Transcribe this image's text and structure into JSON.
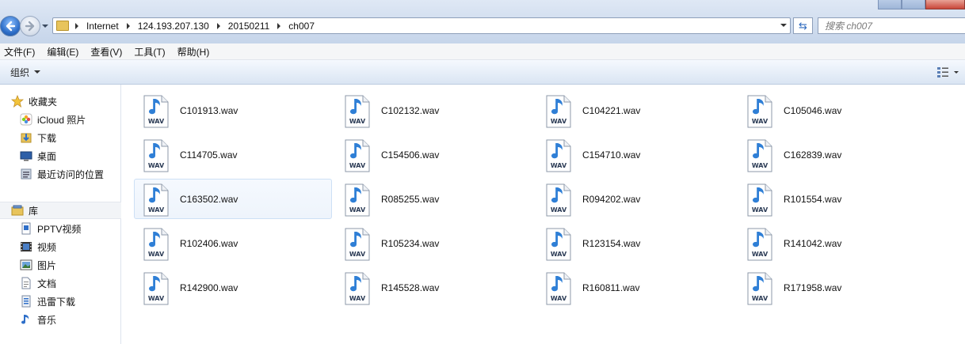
{
  "address": {
    "breadcrumbs": [
      "Internet",
      "124.193.207.130",
      "20150211",
      "ch007"
    ]
  },
  "search": {
    "placeholder": "搜索 ch007"
  },
  "menu": [
    "文件(F)",
    "编辑(E)",
    "查看(V)",
    "工具(T)",
    "帮助(H)"
  ],
  "toolbar": {
    "organize_label": "组织"
  },
  "nav": {
    "favorites_label": "收藏夹",
    "favorites": [
      {
        "label": "iCloud 照片",
        "icon": "icloud-photos-icon"
      },
      {
        "label": "下载",
        "icon": "downloads-icon"
      },
      {
        "label": "桌面",
        "icon": "desktop-icon"
      },
      {
        "label": "最近访问的位置",
        "icon": "recent-places-icon"
      }
    ],
    "libraries_label": "库",
    "libraries": [
      {
        "label": "PPTV视频",
        "icon": "pptv-video-icon"
      },
      {
        "label": "视频",
        "icon": "video-icon"
      },
      {
        "label": "图片",
        "icon": "pictures-icon"
      },
      {
        "label": "文档",
        "icon": "documents-icon"
      },
      {
        "label": "迅雷下载",
        "icon": "thunder-download-icon"
      },
      {
        "label": "音乐",
        "icon": "music-icon"
      }
    ]
  },
  "files": [
    "C101913.wav",
    "C102132.wav",
    "C104221.wav",
    "C105046.wav",
    "C114705.wav",
    "C154506.wav",
    "C154710.wav",
    "C162839.wav",
    "C163502.wav",
    "R085255.wav",
    "R094202.wav",
    "R101554.wav",
    "R102406.wav",
    "R105234.wav",
    "R123154.wav",
    "R141042.wav",
    "R142900.wav",
    "R145528.wav",
    "R160811.wav",
    "R171958.wav"
  ],
  "file_icon_label": "WAV",
  "selected_file_index": 8,
  "colors": {
    "accent": "#2e6fc9",
    "selection": "#cde0f5",
    "chrome": "#dae5f3"
  }
}
